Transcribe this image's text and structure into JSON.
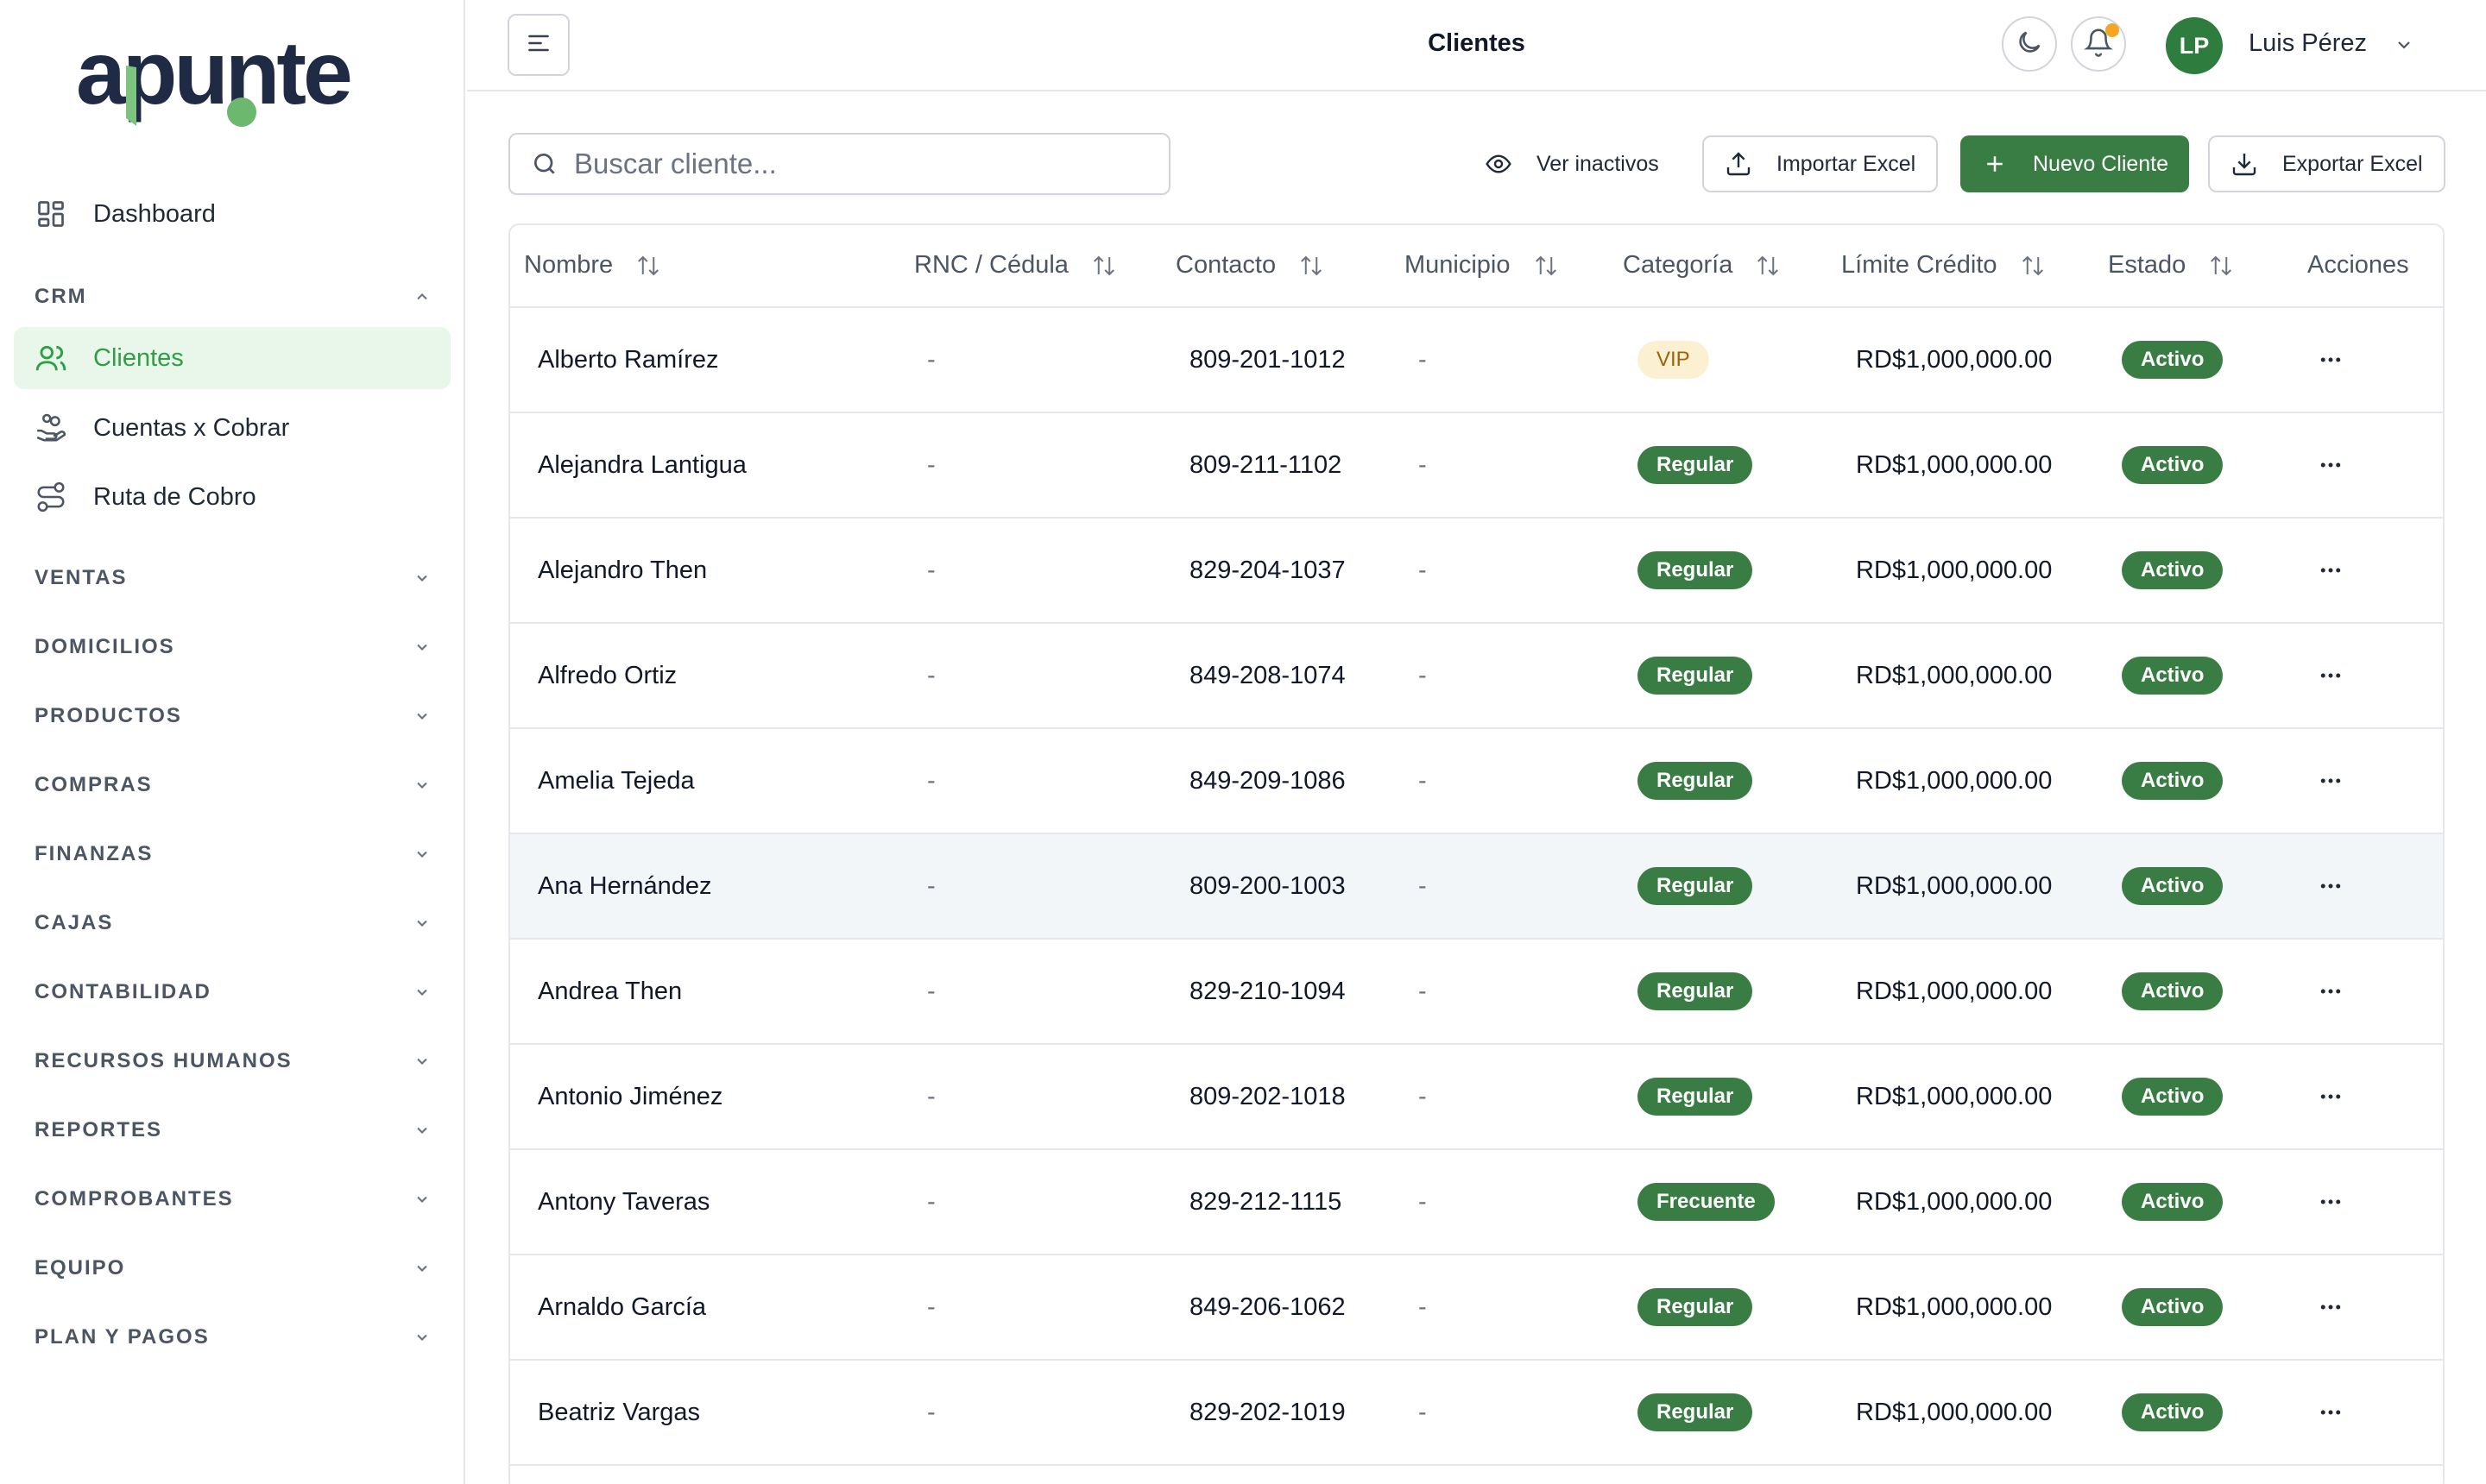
{
  "logo": {
    "text": "apunte"
  },
  "colors": {
    "accent": "#3a7d44",
    "active_bg": "#e8f7ea",
    "active_text": "#2f9e44",
    "notification": "#f5a524"
  },
  "sidebar": {
    "top_items": [
      {
        "label": "Dashboard",
        "icon": "dashboard-grid-icon"
      }
    ],
    "crm_section": {
      "label": "CRM",
      "expanded": true,
      "items": [
        {
          "label": "Clientes",
          "icon": "users-icon",
          "active": true
        },
        {
          "label": "Cuentas x Cobrar",
          "icon": "hand-coins-icon",
          "active": false
        },
        {
          "label": "Ruta de Cobro",
          "icon": "route-icon",
          "active": false
        }
      ]
    },
    "sections": [
      {
        "label": "VENTAS"
      },
      {
        "label": "DOMICILIOS"
      },
      {
        "label": "PRODUCTOS"
      },
      {
        "label": "COMPRAS"
      },
      {
        "label": "FINANZAS"
      },
      {
        "label": "CAJAS"
      },
      {
        "label": "CONTABILIDAD"
      },
      {
        "label": "RECURSOS HUMANOS"
      },
      {
        "label": "REPORTES"
      },
      {
        "label": "COMPROBANTES"
      },
      {
        "label": "EQUIPO"
      },
      {
        "label": "PLAN Y PAGOS"
      }
    ]
  },
  "header": {
    "title": "Clientes",
    "user": {
      "initials": "LP",
      "name": "Luis Pérez"
    }
  },
  "toolbar": {
    "search_placeholder": "Buscar cliente...",
    "view_inactive": "Ver inactivos",
    "import": "Importar Excel",
    "new_client": "Nuevo Cliente",
    "export": "Exportar Excel"
  },
  "table": {
    "columns": [
      "Nombre",
      "RNC / Cédula",
      "Contacto",
      "Municipio",
      "Categoría",
      "Límite Crédito",
      "Estado",
      "Acciones"
    ],
    "rows": [
      {
        "name": "Alberto Ramírez",
        "rnc": "-",
        "contact": "809-201-1012",
        "municipio": "-",
        "category": "VIP",
        "limit": "RD$1,000,000.00",
        "status": "Activo"
      },
      {
        "name": "Alejandra Lantigua",
        "rnc": "-",
        "contact": "809-211-1102",
        "municipio": "-",
        "category": "Regular",
        "limit": "RD$1,000,000.00",
        "status": "Activo"
      },
      {
        "name": "Alejandro Then",
        "rnc": "-",
        "contact": "829-204-1037",
        "municipio": "-",
        "category": "Regular",
        "limit": "RD$1,000,000.00",
        "status": "Activo"
      },
      {
        "name": "Alfredo Ortiz",
        "rnc": "-",
        "contact": "849-208-1074",
        "municipio": "-",
        "category": "Regular",
        "limit": "RD$1,000,000.00",
        "status": "Activo"
      },
      {
        "name": "Amelia Tejeda",
        "rnc": "-",
        "contact": "849-209-1086",
        "municipio": "-",
        "category": "Regular",
        "limit": "RD$1,000,000.00",
        "status": "Activo"
      },
      {
        "name": "Ana Hernández",
        "rnc": "-",
        "contact": "809-200-1003",
        "municipio": "-",
        "category": "Regular",
        "limit": "RD$1,000,000.00",
        "status": "Activo",
        "hover": true
      },
      {
        "name": "Andrea Then",
        "rnc": "-",
        "contact": "829-210-1094",
        "municipio": "-",
        "category": "Regular",
        "limit": "RD$1,000,000.00",
        "status": "Activo"
      },
      {
        "name": "Antonio Jiménez",
        "rnc": "-",
        "contact": "809-202-1018",
        "municipio": "-",
        "category": "Regular",
        "limit": "RD$1,000,000.00",
        "status": "Activo"
      },
      {
        "name": "Antony Taveras",
        "rnc": "-",
        "contact": "829-212-1115",
        "municipio": "-",
        "category": "Frecuente",
        "limit": "RD$1,000,000.00",
        "status": "Activo"
      },
      {
        "name": "Arnaldo García",
        "rnc": "-",
        "contact": "849-206-1062",
        "municipio": "-",
        "category": "Regular",
        "limit": "RD$1,000,000.00",
        "status": "Activo"
      },
      {
        "name": "Beatriz Vargas",
        "rnc": "-",
        "contact": "829-202-1019",
        "municipio": "-",
        "category": "Regular",
        "limit": "RD$1,000,000.00",
        "status": "Activo"
      }
    ]
  }
}
